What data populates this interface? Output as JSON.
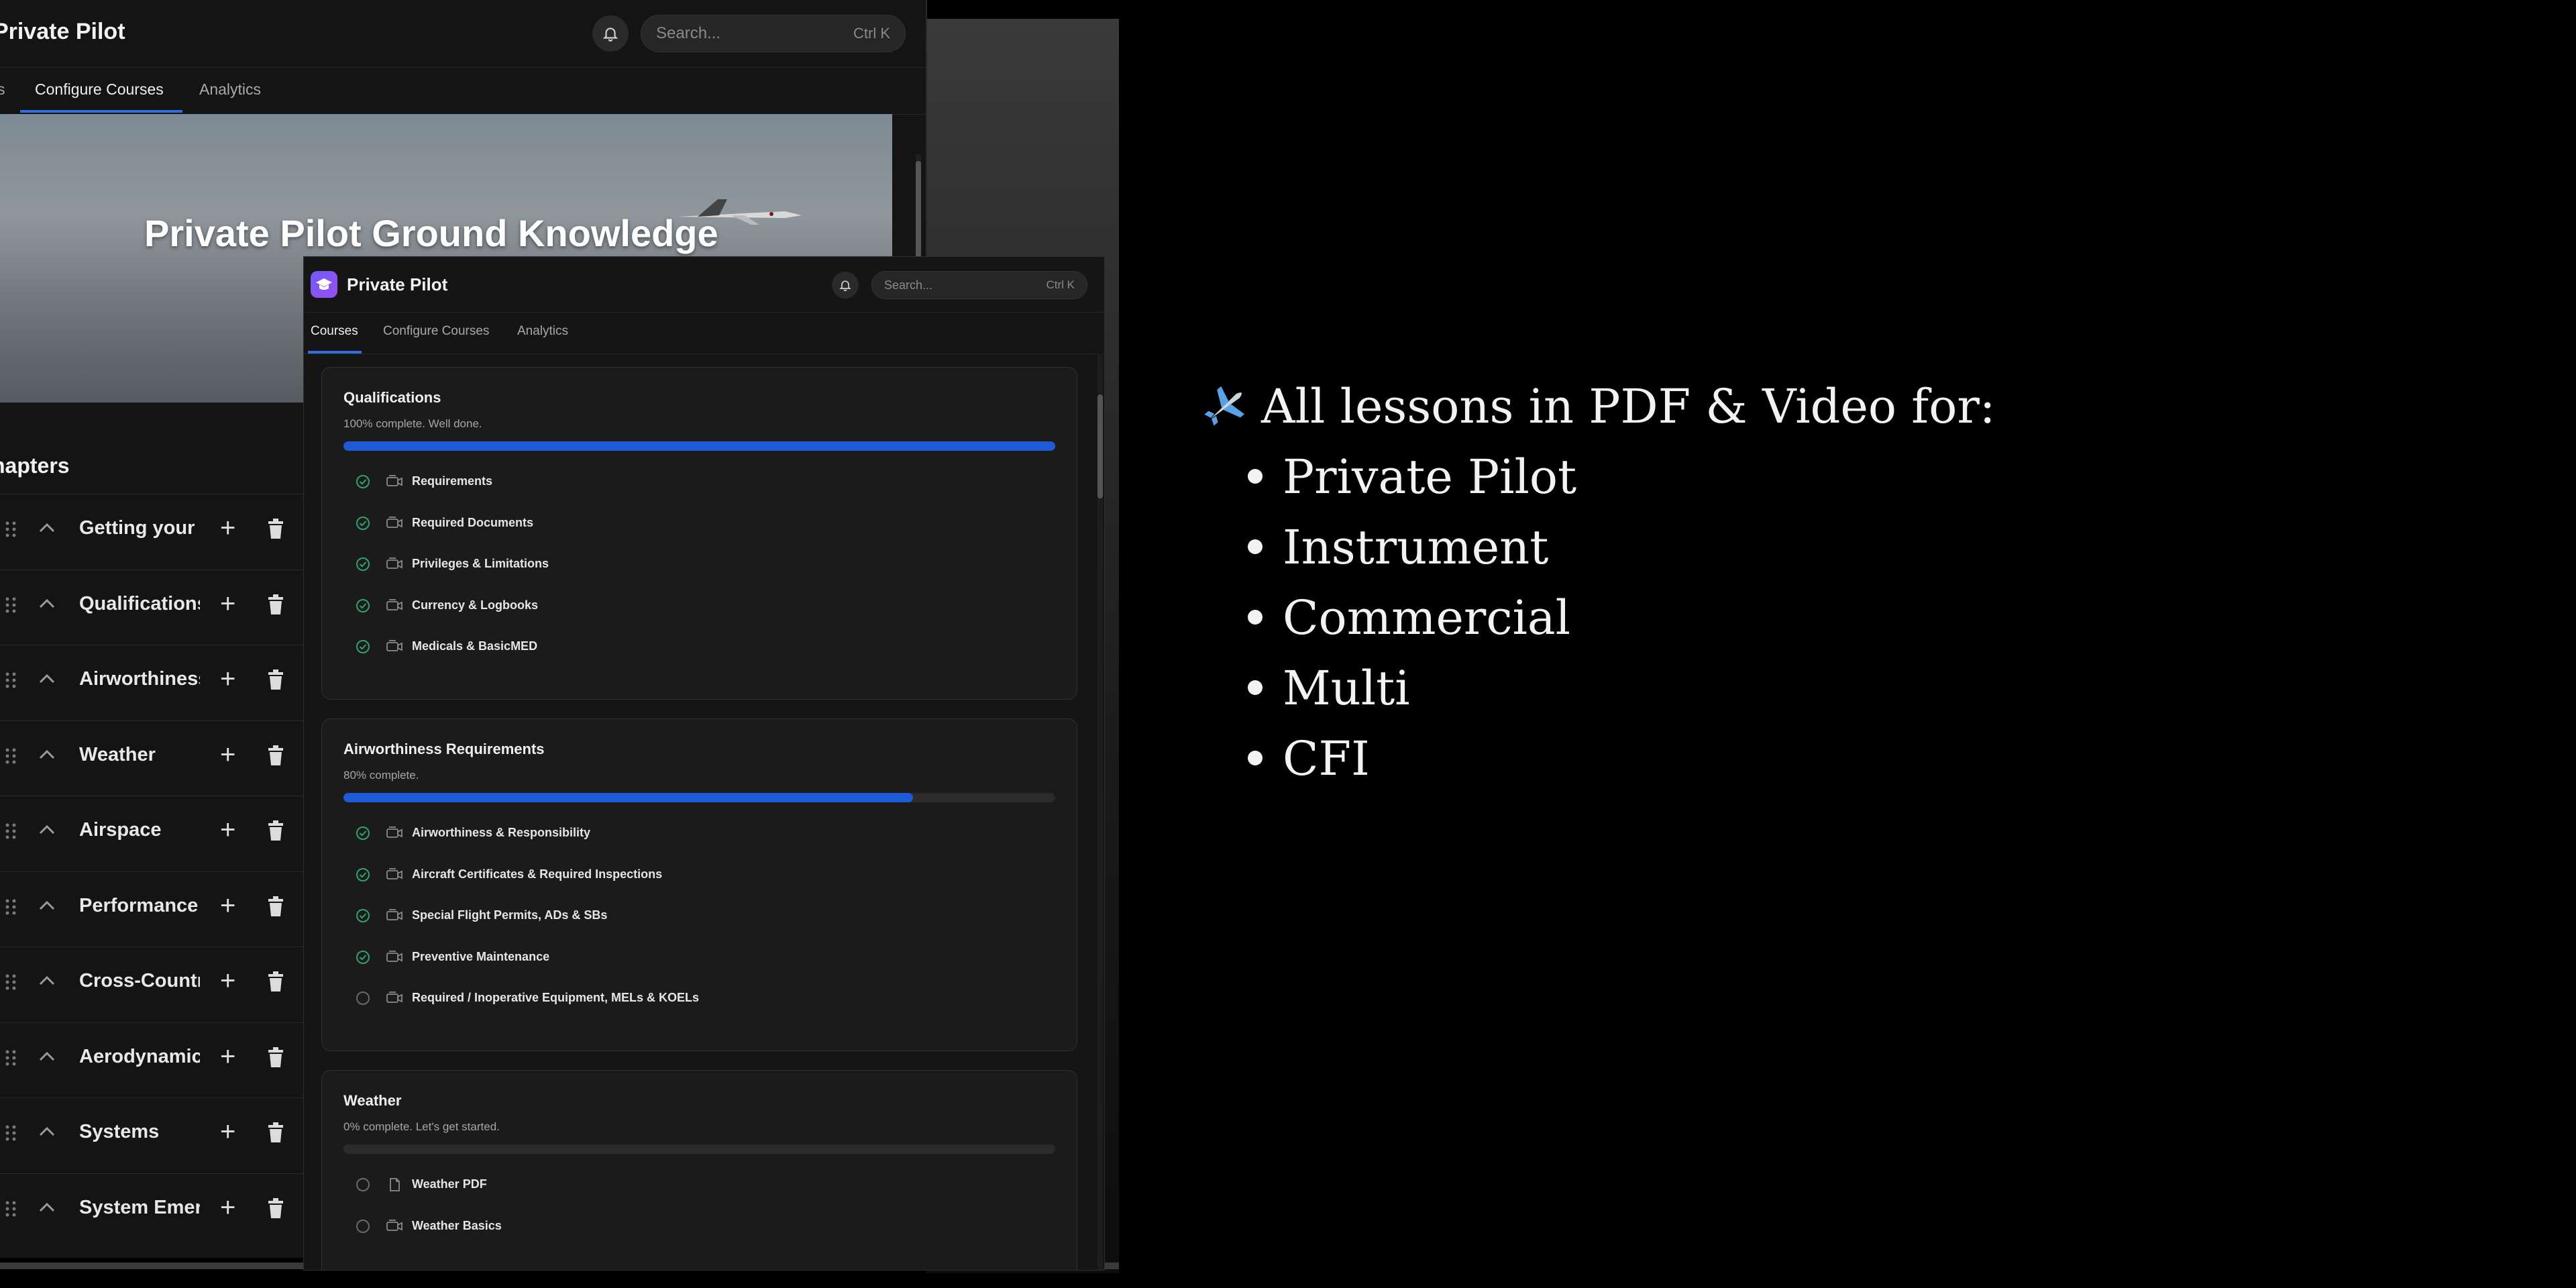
{
  "back_window": {
    "title": "Private Pilot",
    "search": {
      "placeholder": "Search...",
      "shortcut": "Ctrl K"
    },
    "tabs": [
      {
        "label": "s"
      },
      {
        "label": "Configure Courses",
        "active": true
      },
      {
        "label": "Analytics"
      }
    ],
    "hero_title": "Private Pilot Ground Knowledge",
    "chapters_title": "hapters",
    "chapters": [
      "Getting your P",
      "Qualifications",
      "Airworthiness",
      "Weather",
      "Airspace",
      "Performance &",
      "Cross-Country",
      "Aerodynamics",
      "Systems",
      "System Emerg"
    ]
  },
  "front_window": {
    "title": "Private Pilot",
    "search": {
      "placeholder": "Search...",
      "shortcut": "Ctrl K"
    },
    "tabs": [
      {
        "label": "Courses",
        "active": true
      },
      {
        "label": "Configure Courses"
      },
      {
        "label": "Analytics"
      }
    ],
    "sections": [
      {
        "title": "Qualifications",
        "status": "100% complete. Well done.",
        "progress": 1.0,
        "lessons": [
          {
            "label": "Requirements",
            "done": true,
            "type": "video-icon"
          },
          {
            "label": "Required Documents",
            "done": true,
            "type": "video-icon"
          },
          {
            "label": "Privileges & Limitations",
            "done": true,
            "type": "video-icon"
          },
          {
            "label": "Currency & Logbooks",
            "done": true,
            "type": "video-icon"
          },
          {
            "label": "Medicals & BasicMED",
            "done": true,
            "type": "video-icon"
          }
        ]
      },
      {
        "title": "Airworthiness Requirements",
        "status": "80% complete.",
        "progress": 0.8,
        "lessons": [
          {
            "label": "Airworthiness & Responsibility",
            "done": true,
            "type": "video-icon"
          },
          {
            "label": "Aircraft Certificates & Required Inspections",
            "done": true,
            "type": "video-icon"
          },
          {
            "label": "Special Flight Permits, ADs & SBs",
            "done": true,
            "type": "video-icon"
          },
          {
            "label": "Preventive Maintenance",
            "done": true,
            "type": "video-icon"
          },
          {
            "label": "Required / Inoperative Equipment, MELs & KOELs",
            "done": false,
            "type": "video-icon"
          }
        ]
      },
      {
        "title": "Weather",
        "status": "0% complete. Let's get started.",
        "progress": 0.0,
        "lessons": [
          {
            "label": "Weather PDF",
            "done": false,
            "type": "document-icon"
          },
          {
            "label": "Weather Basics",
            "done": false,
            "type": "video-icon"
          }
        ]
      }
    ]
  },
  "promo": {
    "heading": "All lessons in PDF & Video for:",
    "items": [
      "Private Pilot",
      "Instrument",
      "Commercial",
      "Multi",
      "CFI"
    ]
  },
  "colors": {
    "accent": "#1f5bd6",
    "background": "#000000",
    "panel": "#151515",
    "check": "#2fa36b"
  }
}
